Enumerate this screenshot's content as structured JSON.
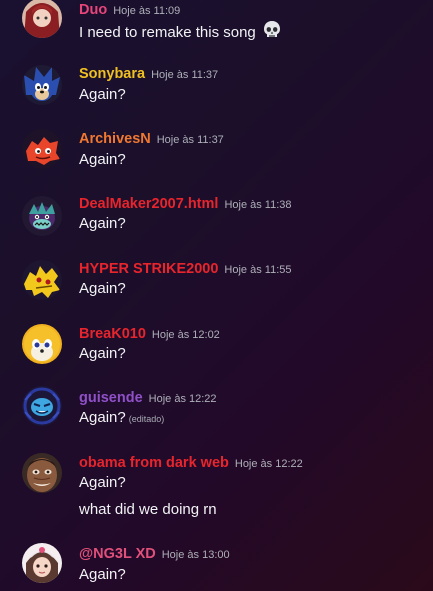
{
  "messages": [
    {
      "author": "Duo",
      "author_color": "#e8457a",
      "time": "Hoje às 11:09",
      "lines": [
        "I need to remake this song"
      ],
      "emoji": "skull-emoji"
    },
    {
      "author": "Sonybara",
      "author_color": "#f0c020",
      "time": "Hoje às 11:37",
      "lines": [
        "Again?"
      ]
    },
    {
      "author": "ArchivesN",
      "author_color": "#f07830",
      "time": "Hoje às 11:37",
      "lines": [
        "Again?"
      ]
    },
    {
      "author": "DealMaker2007.html",
      "author_color": "#e8242c",
      "time": "Hoje às 11:38",
      "lines": [
        "Again?"
      ]
    },
    {
      "author": "HYPER STRIKE2000",
      "author_color": "#e8242c",
      "time": "Hoje às 11:55",
      "lines": [
        "Again?"
      ]
    },
    {
      "author": "BreaK010",
      "author_color": "#e8242c",
      "time": "Hoje às 12:02",
      "lines": [
        "Again?"
      ]
    },
    {
      "author": "guisende",
      "author_color": "#9050c8",
      "time": "Hoje às 12:22",
      "lines": [
        "Again?"
      ],
      "edited_label": "(editado)"
    },
    {
      "author": "obama from dark web",
      "author_color": "#e8242c",
      "time": "Hoje às 12:22",
      "lines": [
        "Again?",
        "what did we doing rn"
      ]
    },
    {
      "author": "@NG3L XD",
      "author_color": "#e0507a",
      "time": "Hoje às 13:00",
      "lines": [
        "Again?"
      ]
    }
  ]
}
